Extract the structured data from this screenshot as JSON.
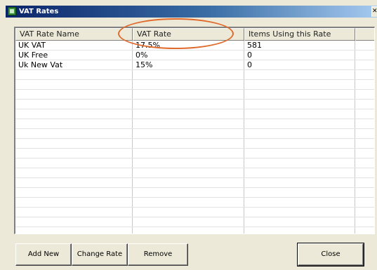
{
  "window": {
    "title": "VAT Rates",
    "close_glyph": "✕"
  },
  "table": {
    "columns": [
      "VAT Rate Name",
      "VAT Rate",
      "Items Using this Rate",
      ""
    ],
    "rows": [
      [
        "UK VAT",
        "17.5%",
        "581"
      ],
      [
        "UK Free",
        "0%",
        "0"
      ],
      [
        "Uk New Vat",
        "15%",
        "0"
      ]
    ]
  },
  "buttons": {
    "add_new": "Add New",
    "change_rate": "Change Rate",
    "remove": "Remove",
    "close": "Close"
  },
  "annotation": {
    "color": "#e06a2b"
  }
}
